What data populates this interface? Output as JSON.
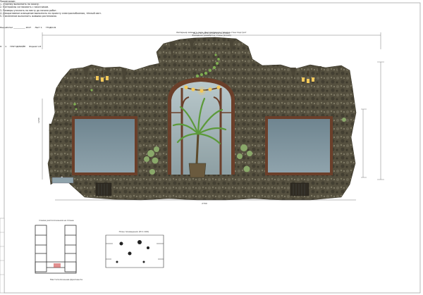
{
  "drawing": {
    "top_dimension": "Высота грота (отметка 0+3 162)",
    "bottom_dimension": "2700",
    "left_dimension": "1260",
    "plan_left_caption": "Схема расположения на плане",
    "plan_left_label": "Местоположение фрагмента",
    "plan_right_caption": "План помещения (М 1:100)",
    "notes_title": "Примечание:",
    "notes": [
      "1. Отделку выполнить по эскизу.",
      "2. Материалы согласовать с заказчиком.",
      "3. Размеры уточнить по месту до начала работ.",
      "4. Декоративное освещение выполнить по проекту электроснабжения, тёплый свет.",
      "5. Озеленение выполнить живыми растениями."
    ],
    "stamp_line": "Разработал ___________ 2017",
    "stamp_number": "Лист 1",
    "title_block": {
      "code": "ГП-ДИ-01",
      "object": "Интерьер зимнего сада. Декоративная отделка стен под грот",
      "sheet_name": "Фасадная развёртка стены (эскиз)",
      "sheet": "1",
      "sheets": "1",
      "stage": "Э",
      "org": "ГРОТ ДИЗАЙН",
      "format": "Формат А3"
    }
  }
}
